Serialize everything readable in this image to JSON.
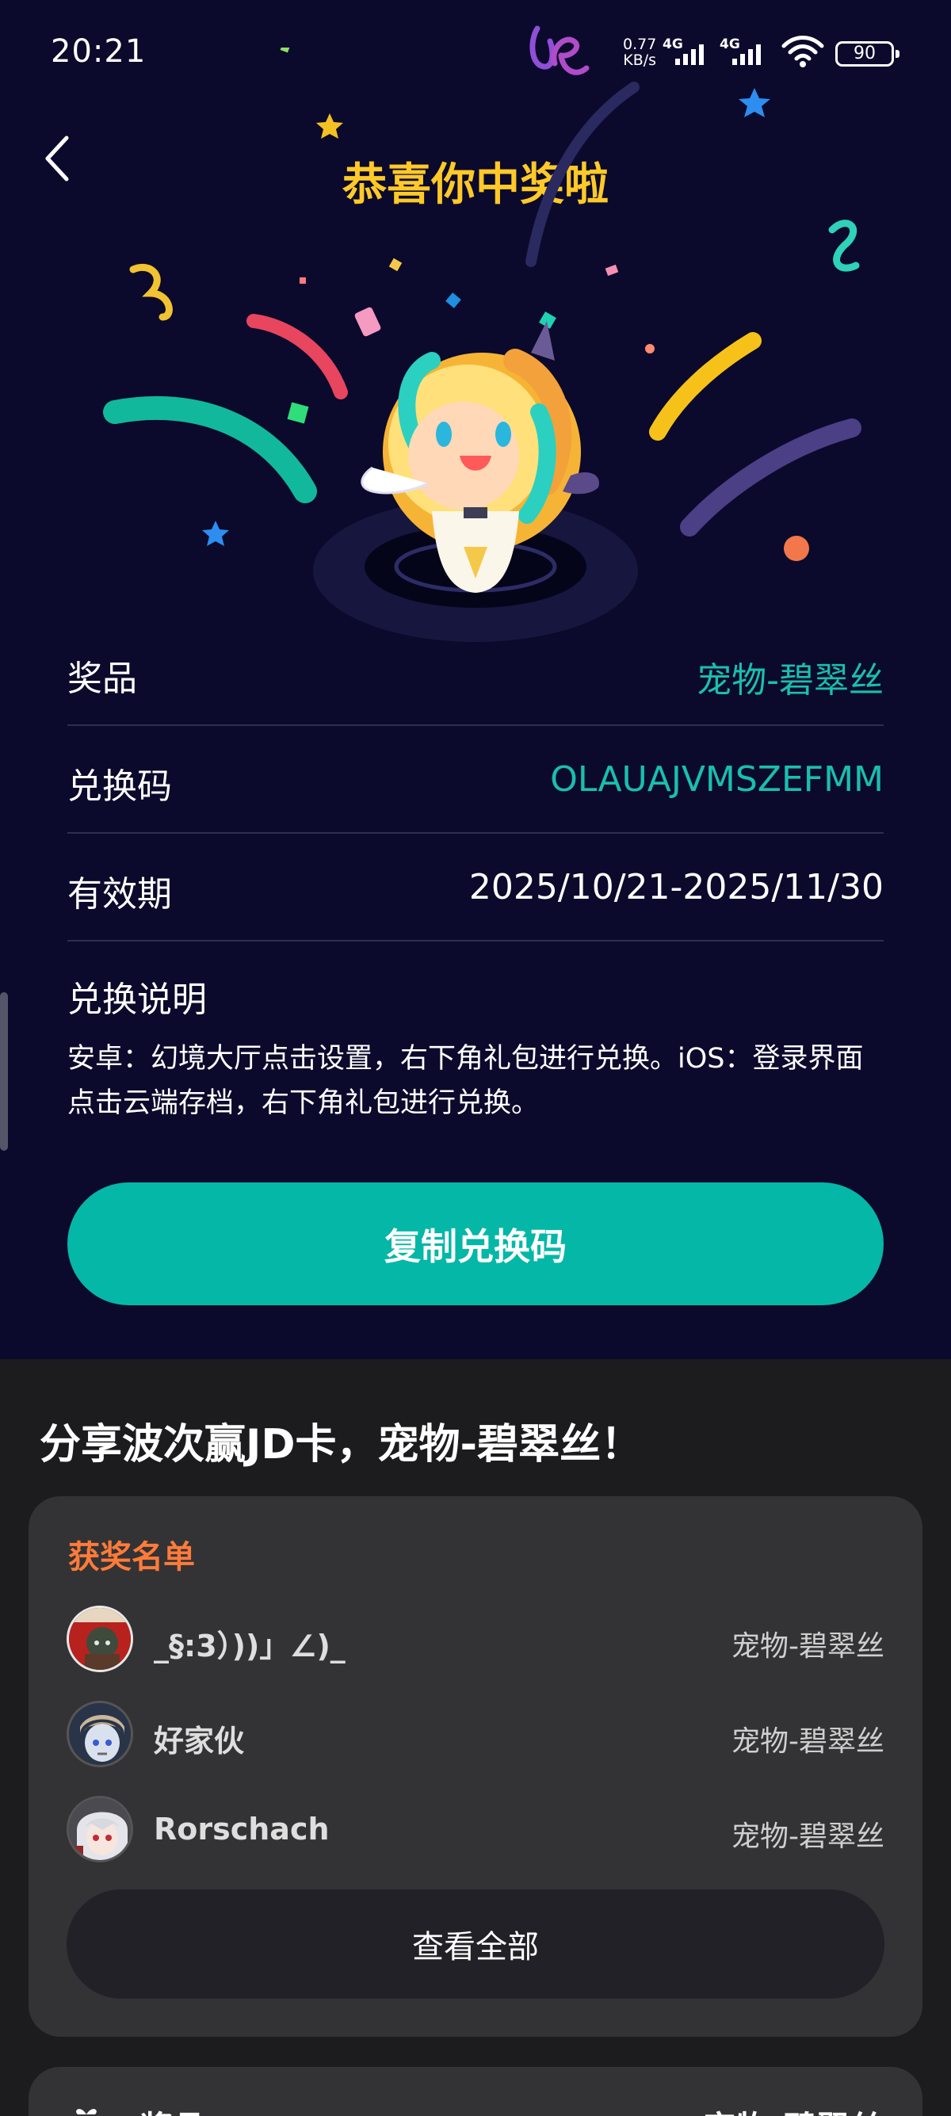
{
  "status_bar": {
    "time": "20:21",
    "speed_value": "0.77",
    "speed_unit": "KB/s",
    "network_1": "4G",
    "network_2": "4G",
    "battery": "90"
  },
  "header": {
    "title": "恭喜你中奖啦"
  },
  "prize_info": {
    "prize_label": "奖品",
    "prize_value": "宠物-碧翠丝",
    "code_label": "兑换码",
    "code_value": "OLAUAJVMSZEFMM",
    "validity_label": "有效期",
    "validity_value": "2025/10/21-2025/11/30",
    "instructions_label": "兑换说明",
    "instructions_text": "安卓：幻境大厅点击设置，右下角礼包进行兑换。iOS：登录界面点击云端存档，右下角礼包进行兑换。"
  },
  "copy_button_label": "复制兑换码",
  "share_title": "分享波次赢JD卡，宠物-碧翠丝！",
  "winners": {
    "title": "获奖名单",
    "list": [
      {
        "name": "_§:3）))」∠)_",
        "prize": "宠物-碧翠丝"
      },
      {
        "name": "好家伙",
        "prize": "宠物-碧翠丝"
      },
      {
        "name": "Rorschach",
        "prize": "宠物-碧翠丝"
      }
    ],
    "view_all_label": "查看全部"
  },
  "next_card": {
    "label": "奖品",
    "value": "宠物-碧翠丝"
  },
  "icons": {
    "back": "back-arrow-icon",
    "wifi": "wifi-icon",
    "battery": "battery-icon",
    "signal": "signal-icon"
  },
  "colors": {
    "accent_teal": "#05b7a6",
    "title_gold": "#ffc928",
    "winners_title": "#ff7b3a",
    "panel_bg": "#0b0a2c"
  }
}
